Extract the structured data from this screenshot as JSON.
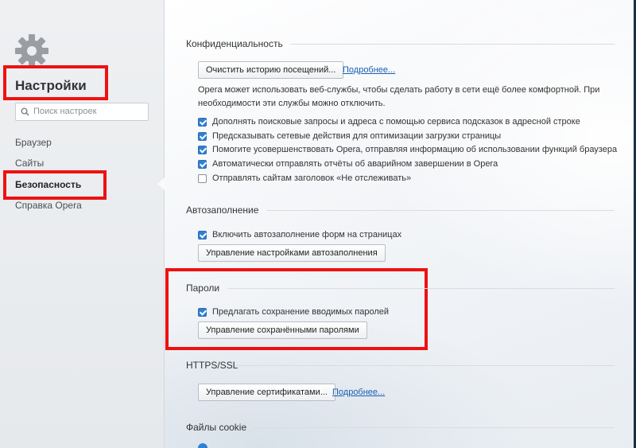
{
  "sidebar": {
    "title": "Настройки",
    "search_placeholder": "Поиск настроек",
    "items": [
      {
        "label": "Браузер"
      },
      {
        "label": "Сайты"
      },
      {
        "label": "Безопасность",
        "active": true
      },
      {
        "label": "Справка Opera"
      }
    ]
  },
  "privacy": {
    "heading": "Конфиденциальность",
    "clear_button": "Очистить историю посещений...",
    "more_link": "Подробнее...",
    "description": "Opera может использовать веб-службы, чтобы сделать работу в сети ещё более комфортной. При необходимости эти службы можно отключить.",
    "options": [
      {
        "label": "Дополнять поисковые запросы и адреса с помощью сервиса подсказок в адресной строке",
        "checked": true
      },
      {
        "label": "Предсказывать сетевые действия для оптимизации загрузки страницы",
        "checked": true
      },
      {
        "label": "Помогите усовершенствовать Opera, отправляя информацию об использовании функций браузера",
        "checked": true
      },
      {
        "label": "Автоматически отправлять отчёты об аварийном завершении в Opera",
        "checked": true
      },
      {
        "label": "Отправлять сайтам заголовок «Не отслеживать»",
        "checked": false
      }
    ]
  },
  "autofill": {
    "heading": "Автозаполнение",
    "option": {
      "label": "Включить автозаполнение форм на страницах",
      "checked": true
    },
    "manage_button": "Управление настройками автозаполнения"
  },
  "passwords": {
    "heading": "Пароли",
    "option": {
      "label": "Предлагать сохранение вводимых паролей",
      "checked": true
    },
    "manage_button": "Управление сохранёнными паролями"
  },
  "https": {
    "heading": "HTTPS/SSL",
    "certs_button": "Управление сертификатами...",
    "more_link": "Подробнее..."
  },
  "cookies": {
    "heading": "Файлы cookie"
  },
  "colors": {
    "accent": "#2f7fd3",
    "link": "#1a5fb4",
    "highlight_box": "#ee1111"
  }
}
